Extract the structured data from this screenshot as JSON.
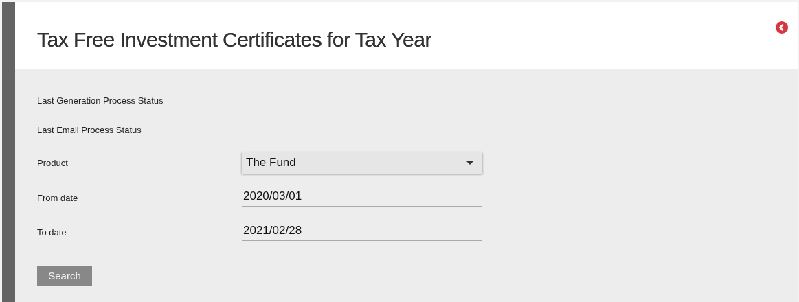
{
  "header": {
    "title": "Tax Free Investment Certificates for Tax Year"
  },
  "fields": [
    {
      "kind": "status",
      "label": "Last Generation Process Status"
    },
    {
      "kind": "status",
      "label": "Last Email Process Status"
    },
    {
      "kind": "select",
      "label": "Product",
      "value": "The Fund"
    },
    {
      "kind": "text",
      "label": "From date",
      "value": "2020/03/01"
    },
    {
      "kind": "text",
      "label": "To date",
      "value": "2021/02/28"
    }
  ],
  "buttons": [
    "Search"
  ]
}
